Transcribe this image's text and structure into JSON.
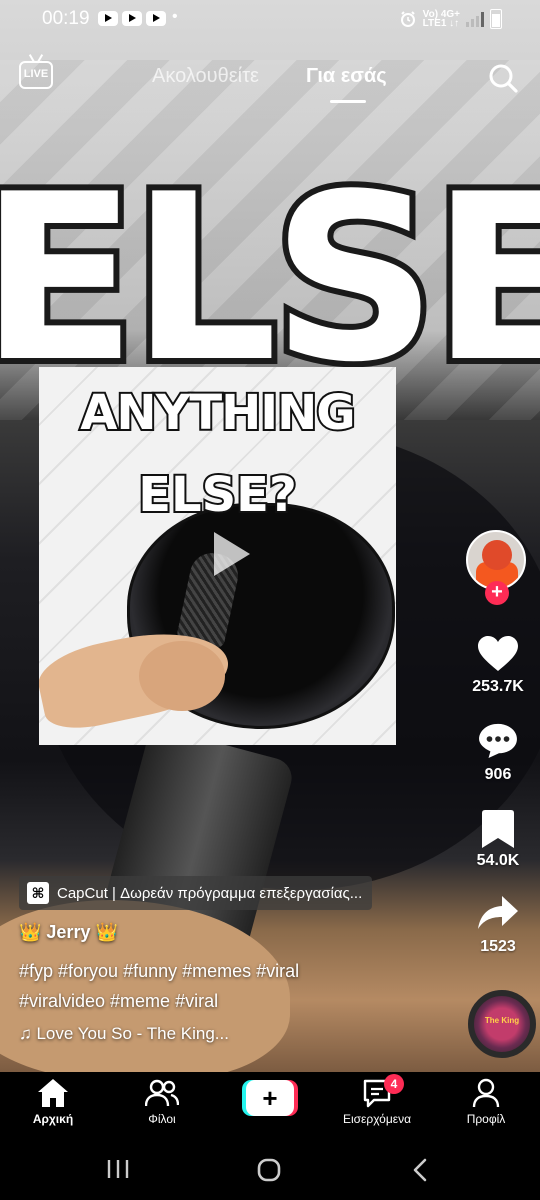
{
  "status_bar": {
    "time": "00:19",
    "dot": "•",
    "network": "Vo) 4G+\nLTE1 ↓↑"
  },
  "top_nav": {
    "live_label": "LIVE",
    "tab_following": "Ακολουθείτε",
    "tab_for_you": "Για εσάς"
  },
  "video": {
    "card_line1": "ANYTHING",
    "card_line2": "ELSE?",
    "background_text": "ELSE?"
  },
  "rail": {
    "likes": "253.7K",
    "comments": "906",
    "saves": "54.0K",
    "shares": "1523",
    "follow_symbol": "+",
    "disc_text": "The King"
  },
  "caption": {
    "capcut_label": "CapCut | Δωρεάν πρόγραμμα επεξεργασίας...",
    "author": "👑 Jerry 👑",
    "tags_line1": "#fyp #foryou #funny #memes #viral",
    "tags_line2": "#viralvideo #meme #viral",
    "song": "♫ Love You So - The King..."
  },
  "bottom_nav": {
    "home": "Αρχική",
    "friends": "Φίλοι",
    "create_symbol": "+",
    "inbox": "Εισερχόμενα",
    "inbox_badge": "4",
    "profile": "Προφίλ"
  },
  "colors": {
    "accent_red": "#fe2c55",
    "accent_cyan": "#25f4ee"
  }
}
